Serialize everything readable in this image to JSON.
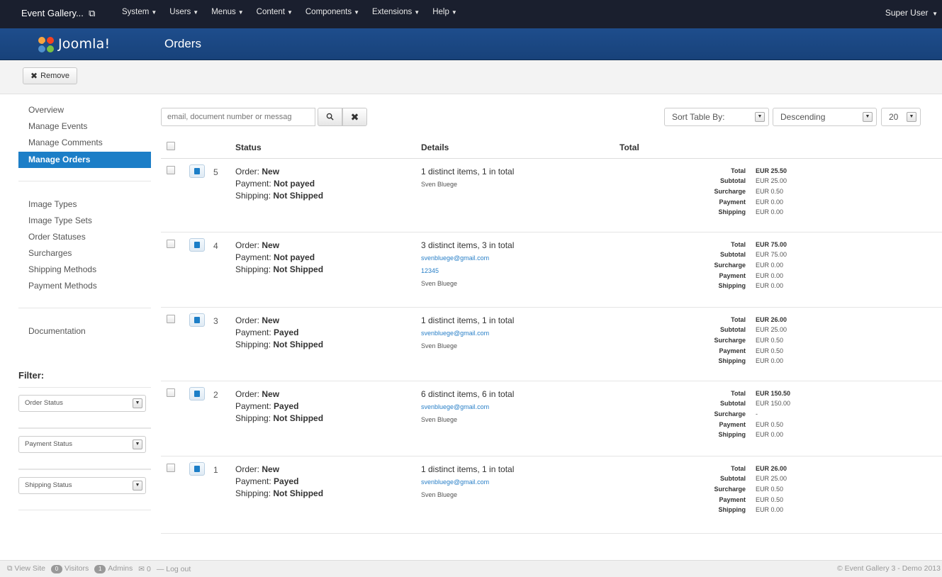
{
  "navbar": {
    "site": "Event Gallery...",
    "menu": [
      "System",
      "Users",
      "Menus",
      "Content",
      "Components",
      "Extensions",
      "Help"
    ],
    "user": "Super User"
  },
  "header": {
    "logo_text": "Joomla!",
    "title": "Orders"
  },
  "toolbar": {
    "remove_label": "Remove"
  },
  "sidebar": {
    "group1": [
      "Overview",
      "Manage Events",
      "Manage Comments",
      "Manage Orders"
    ],
    "active": "Manage Orders",
    "group2": [
      "Image Types",
      "Image Type Sets",
      "Order Statuses",
      "Surcharges",
      "Shipping Methods",
      "Payment Methods"
    ],
    "group3": [
      "Documentation"
    ],
    "filter_title": "Filter:",
    "filters": [
      "Order Status",
      "Payment Status",
      "Shipping Status"
    ]
  },
  "search": {
    "placeholder": "email, document number or messag"
  },
  "sort": {
    "by_label": "Sort Table By:",
    "direction": "Descending",
    "limit": "20"
  },
  "table": {
    "headers": [
      "Status",
      "Details",
      "Total"
    ],
    "status_labels": {
      "order": "Order:",
      "payment": "Payment:",
      "shipping": "Shipping:"
    },
    "total_labels": [
      "Total",
      "Subtotal",
      "Surcharge",
      "Payment",
      "Shipping"
    ],
    "rows": [
      {
        "id": "5",
        "order": "New",
        "payment": "Not payed",
        "shipping": "Not Shipped",
        "items": "1 distinct items, 1 in total",
        "email": "",
        "doc": "",
        "name": "Sven Bluege",
        "totals": [
          "EUR 25.50",
          "EUR 25.00",
          "EUR 0.50",
          "EUR 0.00",
          "EUR 0.00"
        ]
      },
      {
        "id": "4",
        "order": "New",
        "payment": "Not payed",
        "shipping": "Not Shipped",
        "items": "3 distinct items, 3 in total",
        "email": "svenbluege@gmail.com",
        "doc": "12345",
        "name": "Sven Bluege",
        "totals": [
          "EUR 75.00",
          "EUR 75.00",
          "EUR 0.00",
          "EUR 0.00",
          "EUR 0.00"
        ]
      },
      {
        "id": "3",
        "order": "New",
        "payment": "Payed",
        "shipping": "Not Shipped",
        "items": "1 distinct items, 1 in total",
        "email": "svenbluege@gmail.com",
        "doc": "",
        "name": "Sven Bluege",
        "totals": [
          "EUR 26.00",
          "EUR 25.00",
          "EUR 0.50",
          "EUR 0.50",
          "EUR 0.00"
        ]
      },
      {
        "id": "2",
        "order": "New",
        "payment": "Payed",
        "shipping": "Not Shipped",
        "items": "6 distinct items, 6 in total",
        "email": "svenbluege@gmail.com",
        "doc": "",
        "name": "Sven Bluege",
        "totals": [
          "EUR 150.50",
          "EUR 150.00",
          "-",
          "EUR 0.50",
          "EUR 0.00"
        ]
      },
      {
        "id": "1",
        "order": "New",
        "payment": "Payed",
        "shipping": "Not Shipped",
        "items": "1 distinct items, 1 in total",
        "email": "svenbluege@gmail.com",
        "doc": "",
        "name": "Sven Bluege",
        "totals": [
          "EUR 26.00",
          "EUR 25.00",
          "EUR 0.50",
          "EUR 0.50",
          "EUR 0.00"
        ]
      }
    ]
  },
  "footer": {
    "view_site": "View Site",
    "visitors_count": "0",
    "visitors": "Visitors",
    "admins_count": "1",
    "admins": "Admins",
    "messages": "0",
    "logout": "Log out",
    "copyright": "© Event Gallery 3 - Demo 2013"
  }
}
